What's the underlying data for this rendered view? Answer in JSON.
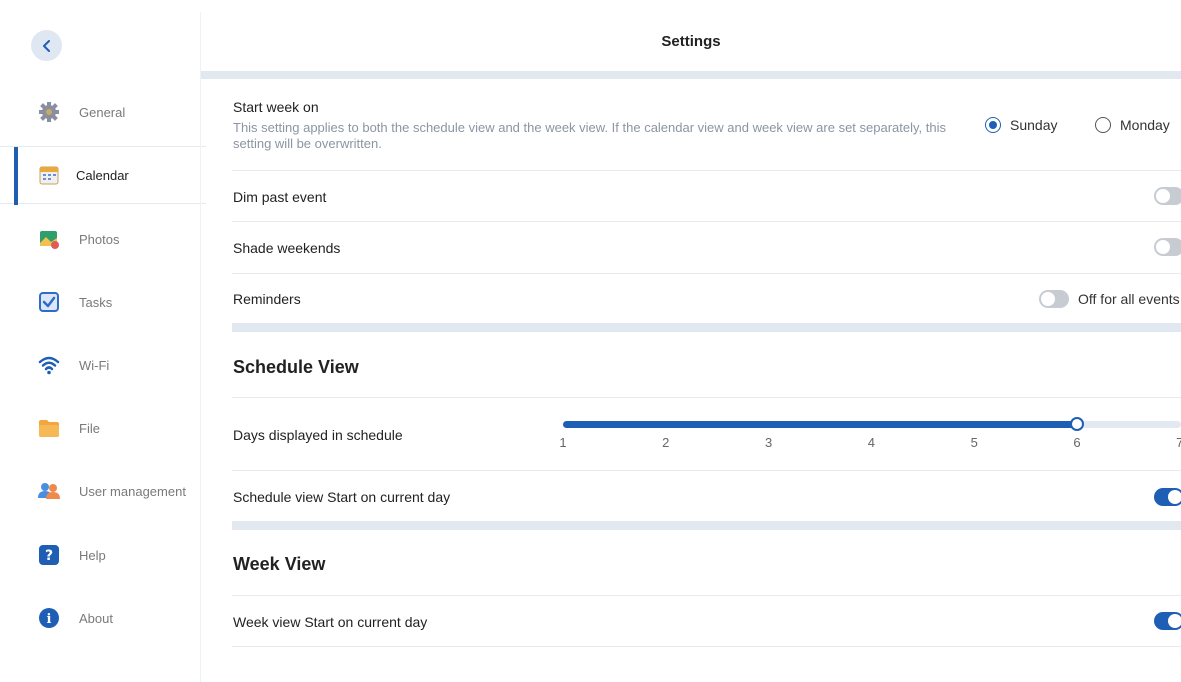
{
  "header": {
    "title": "Settings"
  },
  "sidebar": {
    "items": [
      {
        "label": "General",
        "icon": "gear-icon"
      },
      {
        "label": "Calendar",
        "icon": "calendar-icon"
      },
      {
        "label": "Photos",
        "icon": "photos-icon"
      },
      {
        "label": "Tasks",
        "icon": "checkbox-icon"
      },
      {
        "label": "Wi-Fi",
        "icon": "wifi-icon"
      },
      {
        "label": "File",
        "icon": "folder-icon"
      },
      {
        "label": "User management",
        "icon": "users-icon"
      },
      {
        "label": "Help",
        "icon": "help-icon"
      },
      {
        "label": "About",
        "icon": "info-icon"
      }
    ],
    "active_index": 1
  },
  "start_week": {
    "label": "Start week on",
    "description": "This setting applies to both the schedule view and the week view. If the calendar view and week view are set separately, this setting will be overwritten.",
    "options": [
      "Sunday",
      "Monday"
    ],
    "selected": "Sunday"
  },
  "dim_past_event": {
    "label": "Dim past event",
    "enabled": false
  },
  "shade_weekends": {
    "label": "Shade weekends",
    "enabled": false
  },
  "reminders": {
    "label": "Reminders",
    "enabled": false,
    "status_text": "Off for all events"
  },
  "schedule_view": {
    "title": "Schedule View",
    "days_label": "Days displayed in schedule",
    "days_min": 1,
    "days_max": 7,
    "days_value": 6,
    "ticks": [
      "1",
      "2",
      "3",
      "4",
      "5",
      "6",
      "7"
    ],
    "start_current_label": "Schedule view Start on current day",
    "start_current_enabled": true
  },
  "week_view": {
    "title": "Week View",
    "start_current_label": "Week view Start on current day",
    "start_current_enabled": true
  },
  "colors": {
    "accent": "#1e5fb5",
    "band": "#e2e8f0"
  }
}
